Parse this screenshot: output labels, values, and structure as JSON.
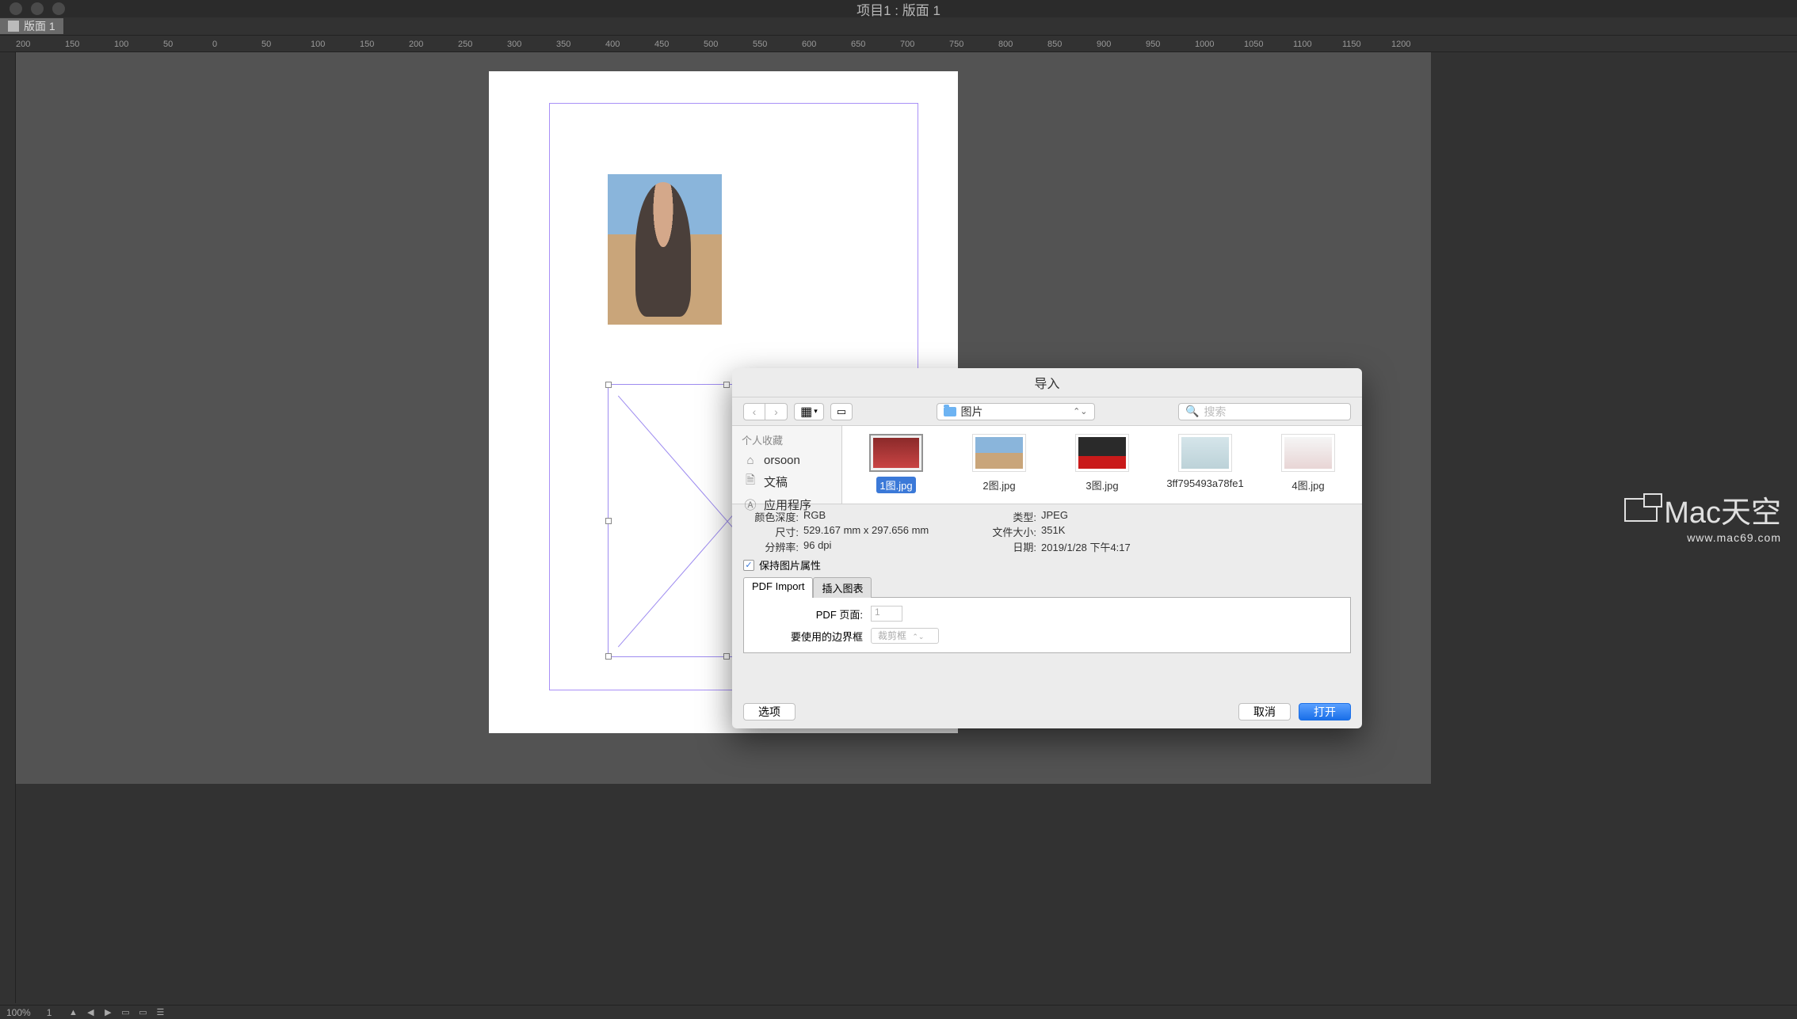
{
  "app": {
    "title": "项目1 : 版面 1"
  },
  "tabs": {
    "doc1": "版面 1"
  },
  "ruler": {
    "marks": [
      "200",
      "150",
      "100",
      "50",
      "0",
      "50",
      "100",
      "150",
      "200",
      "250",
      "300",
      "350",
      "400",
      "450",
      "500",
      "550",
      "600",
      "650",
      "700",
      "750",
      "800",
      "850",
      "900",
      "950",
      "1000",
      "1050",
      "1100",
      "1150",
      "1200"
    ]
  },
  "dialog": {
    "title": "导入",
    "path_folder": "图片",
    "search_placeholder": "搜索",
    "sidebar": {
      "header": "个人收藏",
      "items": [
        "orsoon",
        "文稿",
        "应用程序"
      ]
    },
    "files": [
      {
        "name": "1图.jpg",
        "selected": true
      },
      {
        "name": "2图.jpg",
        "selected": false
      },
      {
        "name": "3图.jpg",
        "selected": false
      },
      {
        "name": "3ff795493a78fe1",
        "selected": false
      },
      {
        "name": "4图.jpg",
        "selected": false
      }
    ],
    "info": {
      "color_depth_label": "颜色深度:",
      "color_depth": "RGB",
      "size_label": "尺寸:",
      "size": "529.167 mm x 297.656 mm",
      "dpi_label": "分辨率:",
      "dpi": "96 dpi",
      "type_label": "类型:",
      "type": "JPEG",
      "filesize_label": "文件大小:",
      "filesize": "351K",
      "date_label": "日期:",
      "date": "2019/1/28  下午4:17",
      "checkbox": "保持图片属性"
    },
    "tabs": {
      "pdf": "PDF Import",
      "chart": "插入图表"
    },
    "form": {
      "pdf_page_label": "PDF 页面:",
      "pdf_page_value": "1",
      "bbox_label": "要使用的边界框",
      "bbox_value": "裁剪框"
    },
    "buttons": {
      "options": "选项",
      "cancel": "取消",
      "open": "打开"
    }
  },
  "watermark": {
    "brand": "Mac天空",
    "url": "www.mac69.com"
  },
  "status": {
    "zoom": "100%",
    "page": "1"
  }
}
